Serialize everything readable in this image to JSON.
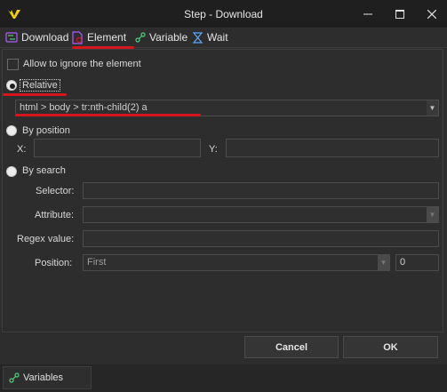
{
  "window": {
    "title": "Step - Download",
    "controls": {
      "minimize": "—",
      "maximize": "☐",
      "close": "✕"
    }
  },
  "tabs": [
    {
      "label": "Download",
      "icon": "download-step-icon"
    },
    {
      "label": "Element",
      "icon": "element-icon",
      "active": true
    },
    {
      "label": "Variable",
      "icon": "variable-icon"
    },
    {
      "label": "Wait",
      "icon": "hourglass-icon"
    }
  ],
  "element": {
    "allow_ignore_label": "Allow to ignore the element",
    "relative_label": "Relative",
    "relative_selector_value": "html > body > tr:nth-child(2) a",
    "by_position_label": "By position",
    "x_label": "X:",
    "y_label": "Y:",
    "by_search_label": "By search",
    "selector_label": "Selector:",
    "attribute_label": "Attribute:",
    "regex_label": "Regex value:",
    "position_label": "Position:",
    "position_value": "First",
    "position_index": "0"
  },
  "footer": {
    "cancel_label": "Cancel",
    "ok_label": "OK"
  },
  "variables_panel": {
    "label": "Variables"
  },
  "colors": {
    "accent_red": "#d4151c",
    "logo_yellow": "#f5d100",
    "icon_purple": "#b05cff",
    "icon_green": "#4bd17a"
  }
}
